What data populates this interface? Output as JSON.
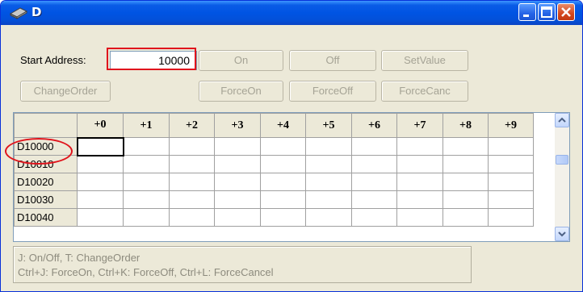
{
  "window": {
    "title": "D",
    "icon": "memory-chip-icon",
    "controls": [
      "minimize-icon",
      "maximize-icon",
      "close-icon"
    ]
  },
  "toolbar": {
    "start_address_label": "Start Address:",
    "start_address_value": "10000",
    "buttons_row1": [
      "On",
      "Off",
      "SetValue"
    ],
    "change_order": "ChangeOrder",
    "buttons_row2": [
      "ForceOn",
      "ForceOff",
      "ForceCanc"
    ]
  },
  "grid": {
    "columns": [
      "+0",
      "+1",
      "+2",
      "+3",
      "+4",
      "+5",
      "+6",
      "+7",
      "+8",
      "+9"
    ],
    "rows": [
      "D10000",
      "D10010",
      "D10020",
      "D10030",
      "D10040"
    ]
  },
  "help": {
    "line1": "J: On/Off,   T: ChangeOrder",
    "line2": "Ctrl+J: ForceOn,   Ctrl+K: ForceOff,   Ctrl+L: ForceCancel"
  },
  "colors": {
    "title_bar": "#0054e3",
    "annotation": "#e0141c",
    "dialog_bg": "#ece9d8"
  }
}
